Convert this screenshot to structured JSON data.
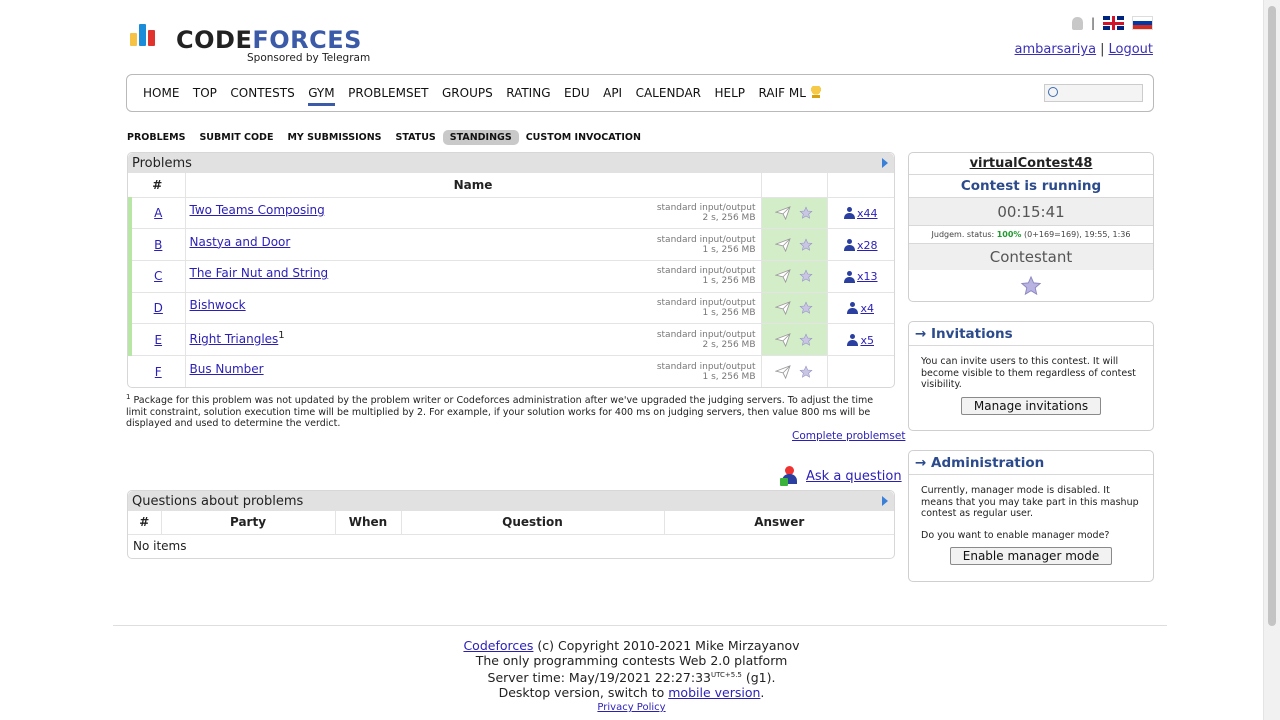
{
  "header": {
    "logo_word_1": "CODE",
    "logo_word_2": "FORCES",
    "sponsor": "Sponsored by Telegram",
    "user": "ambarsariya",
    "logout": "Logout",
    "bar_colors": [
      "#f6c344",
      "#1a8cd8",
      "#e0332d"
    ]
  },
  "menu": [
    "Home",
    "Top",
    "Contests",
    "Gym",
    "Problemset",
    "Groups",
    "Rating",
    "Edu",
    "API",
    "Calendar",
    "Help",
    "RAIF ML"
  ],
  "submenu": [
    "PROBLEMS",
    "SUBMIT CODE",
    "MY SUBMISSIONS",
    "STATUS",
    "STANDINGS",
    "CUSTOM INVOCATION"
  ],
  "problems": {
    "caption": "Problems",
    "col_index": "#",
    "col_name": "Name",
    "rows": [
      {
        "index": "A",
        "name": "Two Teams Composing",
        "io": "standard input/output",
        "limits": "2 s, 256 MB",
        "count": "x44",
        "note": ""
      },
      {
        "index": "B",
        "name": "Nastya and Door",
        "io": "standard input/output",
        "limits": "1 s, 256 MB",
        "count": "x28",
        "note": ""
      },
      {
        "index": "C",
        "name": "The Fair Nut and String",
        "io": "standard input/output",
        "limits": "1 s, 256 MB",
        "count": "x13",
        "note": ""
      },
      {
        "index": "D",
        "name": "Bishwock",
        "io": "standard input/output",
        "limits": "1 s, 256 MB",
        "count": "x4",
        "note": ""
      },
      {
        "index": "E",
        "name": "Right Triangles",
        "io": "standard input/output",
        "limits": "2 s, 256 MB",
        "count": "x5",
        "note": "1"
      },
      {
        "index": "F",
        "name": "Bus Number",
        "io": "standard input/output",
        "limits": "1 s, 256 MB",
        "count": "",
        "note": ""
      }
    ]
  },
  "footnote": {
    "mark": "1",
    "text": "Package for this problem was not updated by the problem writer or Codeforces administration after we've upgraded the judging servers. To adjust the time limit constraint, solution execution time will be multiplied by 2. For example, if your solution works for 400 ms on judging servers, then value 800 ms will be displayed and used to determine the verdict."
  },
  "complete_problemset": "Complete problemset",
  "ask_question": "Ask a question",
  "questions": {
    "caption": "Questions about problems",
    "columns": [
      "#",
      "Party",
      "When",
      "Question",
      "Answer"
    ],
    "empty": "No items"
  },
  "contest": {
    "name": "virtualContest48",
    "state": "Contest is running",
    "timer": "00:15:41",
    "judge_label": "Judgem. status:",
    "judge_pct": "100%",
    "judge_rest": "(0+169=169), 19:55, 1:36",
    "role": "Contestant"
  },
  "invitations": {
    "title": "→ Invitations",
    "text": "You can invite users to this contest. It will become visible to them regardless of contest visibility.",
    "button": "Manage invitations"
  },
  "administration": {
    "title": "→ Administration",
    "text1": "Currently, manager mode is disabled. It means that you may take part in this mashup contest as regular user.",
    "text2": "Do you want to enable manager mode?",
    "button": "Enable manager mode"
  },
  "footer": {
    "line1_link": "Codeforces",
    "line1_rest": " (c) Copyright 2010-2021 Mike Mirzayanov",
    "line2": "The only programming contests Web 2.0 platform",
    "line3_pre": "Server time: May/19/2021 22:27:33",
    "line3_tz": "UTC+5.5",
    "line3_post": " (g1).",
    "line4_pre": "Desktop version, switch to ",
    "line4_link": "mobile version",
    "line4_post": ".",
    "privacy": "Privacy Policy"
  }
}
